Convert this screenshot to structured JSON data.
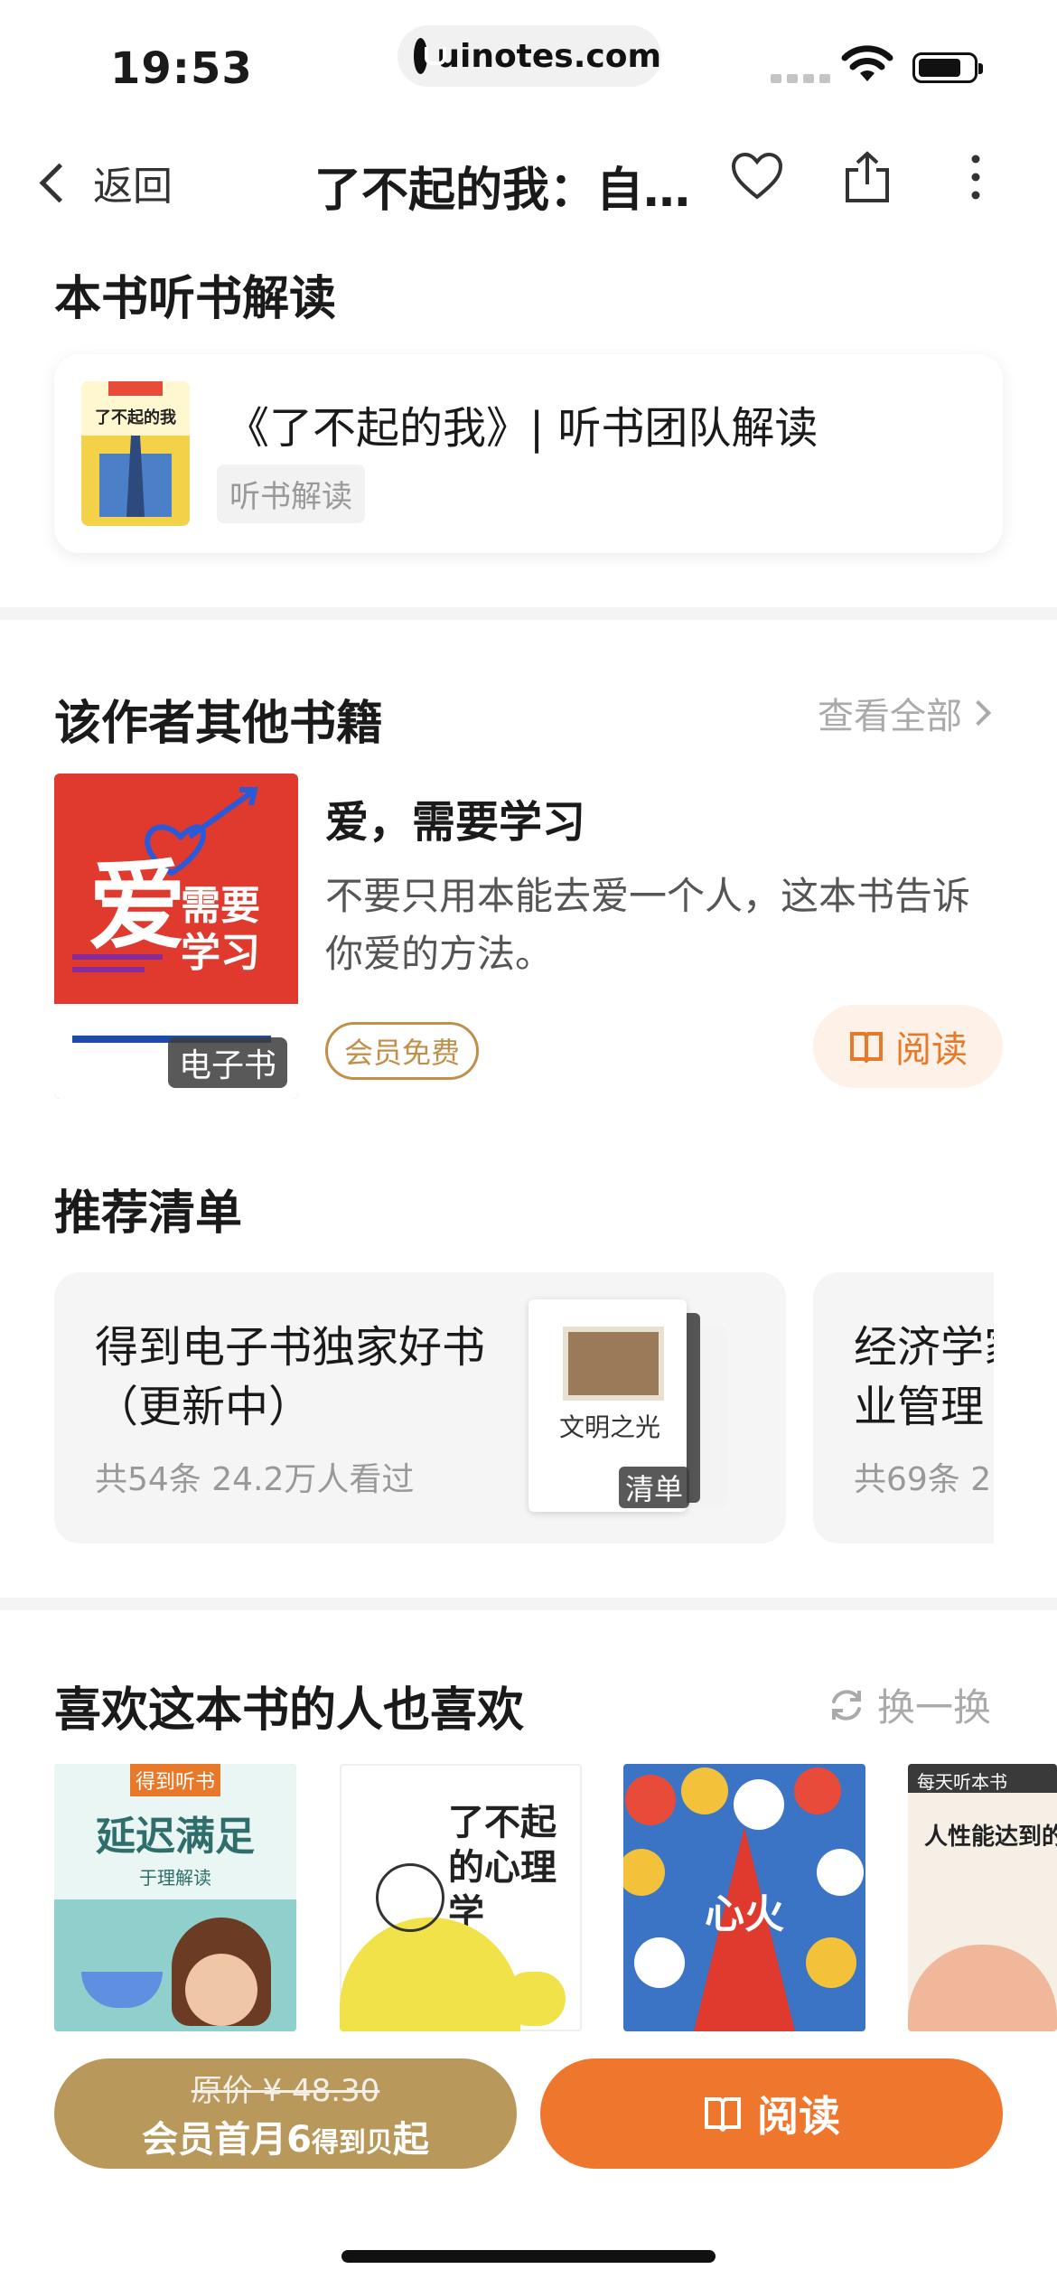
{
  "status_bar": {
    "time": "19:53",
    "url": "uinotes.com"
  },
  "nav": {
    "back_label": "返回",
    "title": "了不起的我：自我发展的心理学"
  },
  "audio_section": {
    "title": "本书听书解读",
    "item": {
      "title": "《了不起的我》| 听书团队解读",
      "tag": "听书解读",
      "cover_text": "了不起的我"
    }
  },
  "author_section": {
    "title": "该作者其他书籍",
    "see_all": "查看全部",
    "book": {
      "title": "爱，需要学习",
      "description": "不要只用本能去爱一个人，这本书告诉你爱的方法。",
      "cover_text_1": "爱",
      "cover_text_2": "需要",
      "cover_text_3": "学习",
      "badge": "电子书",
      "member_tag": "会员免费",
      "read_label": "阅读"
    }
  },
  "list_section": {
    "title": "推荐清单",
    "lists": [
      {
        "title": "得到电子书独家好书（更新中）",
        "meta": "共54条   24.2万人看过",
        "tag": "清单",
        "cover_text": "文明之光"
      },
      {
        "title": "经济学家推荐企业管理",
        "meta": "共69条   2"
      }
    ]
  },
  "also_like_section": {
    "title": "喜欢这本书的人也喜欢",
    "swap_label": "换一换",
    "covers": [
      {
        "title": "延迟满足",
        "top_label": "得到听书",
        "sub": "于理解读"
      },
      {
        "title": "了不起的心理学",
        "top_label": ""
      },
      {
        "title": "心火",
        "top_label": ""
      },
      {
        "title": "人性能达到的",
        "top_label": "每天听本书"
      }
    ]
  },
  "bottom_bar": {
    "original_price": "原价 ¥ 48.30",
    "member_price_prefix": "会员首月6",
    "member_price_unit": "得到贝",
    "member_price_suffix": "起",
    "read_label": "阅读"
  },
  "colors": {
    "accent_orange": "#ef762d",
    "gold": "#b8995b",
    "tag_gold": "#c28f4b"
  }
}
